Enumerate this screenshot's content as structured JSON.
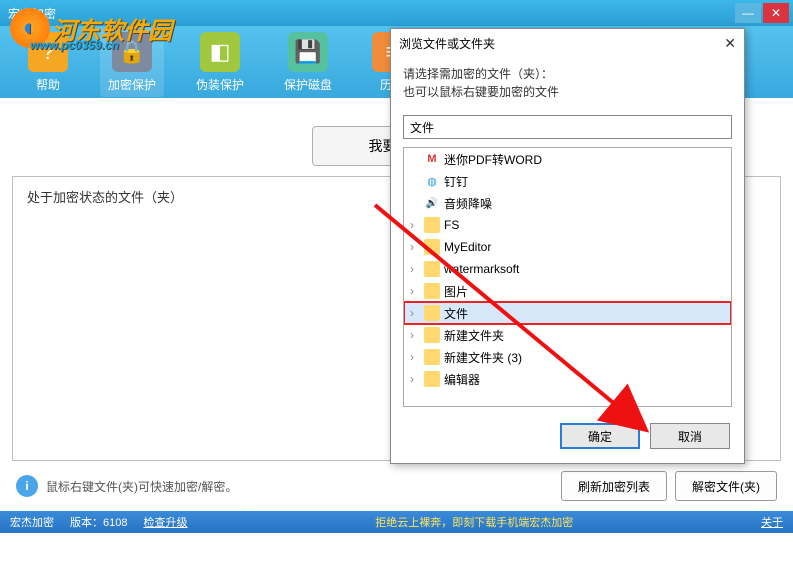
{
  "window": {
    "title": "宏杰加密"
  },
  "watermark": {
    "site": "河东软件园",
    "url": "www.pc0359.cn"
  },
  "toolbar": {
    "items": [
      {
        "label": "帮助",
        "icon": "help-icon"
      },
      {
        "label": "加密保护",
        "icon": "encrypt-icon"
      },
      {
        "label": "伪装保护",
        "icon": "disguise-icon"
      },
      {
        "label": "保护磁盘",
        "icon": "disk-icon"
      },
      {
        "label": "历史",
        "icon": "history-icon"
      }
    ]
  },
  "encrypt_button": "我要加密",
  "panel_header": "处于加密状态的文件（夹）",
  "tip_text": "鼠标右键文件(夹)可快速加密/解密。",
  "bottom_buttons": {
    "refresh": "刷新加密列表",
    "decrypt": "解密文件(夹)"
  },
  "statusbar": {
    "app": "宏杰加密",
    "version_label": "版本：6108",
    "upgrade": "检查升级",
    "promo": "拒绝云上裸奔，即刻下载手机端宏杰加密",
    "about": "关于"
  },
  "dialog": {
    "title": "浏览文件或文件夹",
    "line1": "请选择需加密的文件（夹）：",
    "line2": "也可以鼠标右键要加密的文件",
    "input_value": "文件",
    "items": [
      {
        "icon": "m",
        "color": "#d33",
        "label": "迷你PDF转WORD",
        "expandable": false
      },
      {
        "icon": "globe",
        "color": "#2a9fd6",
        "label": "钉钉",
        "expandable": false
      },
      {
        "icon": "sound",
        "color": "#f5a623",
        "label": "音频降噪",
        "expandable": false
      },
      {
        "icon": "folder",
        "color": "",
        "label": "FS",
        "expandable": true
      },
      {
        "icon": "folder",
        "color": "",
        "label": "MyEditor",
        "expandable": true
      },
      {
        "icon": "folder",
        "color": "",
        "label": "watermarksoft",
        "expandable": true
      },
      {
        "icon": "folder",
        "color": "",
        "label": "图片",
        "expandable": true
      },
      {
        "icon": "folder",
        "color": "",
        "label": "文件",
        "expandable": true,
        "highlight": true
      },
      {
        "icon": "folder",
        "color": "",
        "label": "新建文件夹",
        "expandable": true
      },
      {
        "icon": "folder",
        "color": "",
        "label": "新建文件夹 (3)",
        "expandable": true
      },
      {
        "icon": "folder",
        "color": "",
        "label": "编辑器",
        "expandable": true
      }
    ],
    "ok": "确定",
    "cancel": "取消"
  }
}
